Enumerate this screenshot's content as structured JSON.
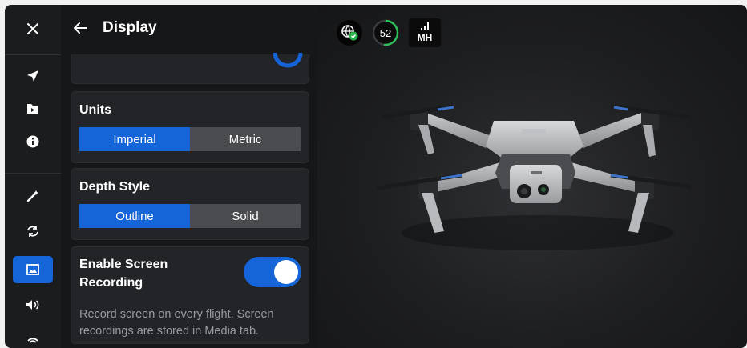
{
  "rail": {
    "close_icon": "close-icon",
    "items": [
      {
        "icon": "navigation-arrow-icon"
      },
      {
        "icon": "folder-icon"
      },
      {
        "icon": "info-icon"
      },
      {
        "icon": "wand-icon"
      },
      {
        "icon": "sync-icon"
      },
      {
        "icon": "display-icon",
        "active": true
      },
      {
        "icon": "volume-icon"
      },
      {
        "icon": "wifi-icon"
      }
    ],
    "accent": "#1565d8"
  },
  "header": {
    "title": "Display",
    "back_icon": "back-arrow-icon"
  },
  "units": {
    "label": "Units",
    "options": [
      "Imperial",
      "Metric"
    ],
    "selected": "Imperial"
  },
  "depth_style": {
    "label": "Depth Style",
    "options": [
      "Outline",
      "Solid"
    ],
    "selected": "Outline"
  },
  "recording": {
    "label": "Enable Screen Recording",
    "enabled": true,
    "description": "Record screen on every flight. Screen recordings are stored in Media tab."
  },
  "status": {
    "gps_icon": "globe-check-icon",
    "battery_percent": "52",
    "signal_icon": "signal-bars-icon",
    "signal_label": "MH"
  }
}
